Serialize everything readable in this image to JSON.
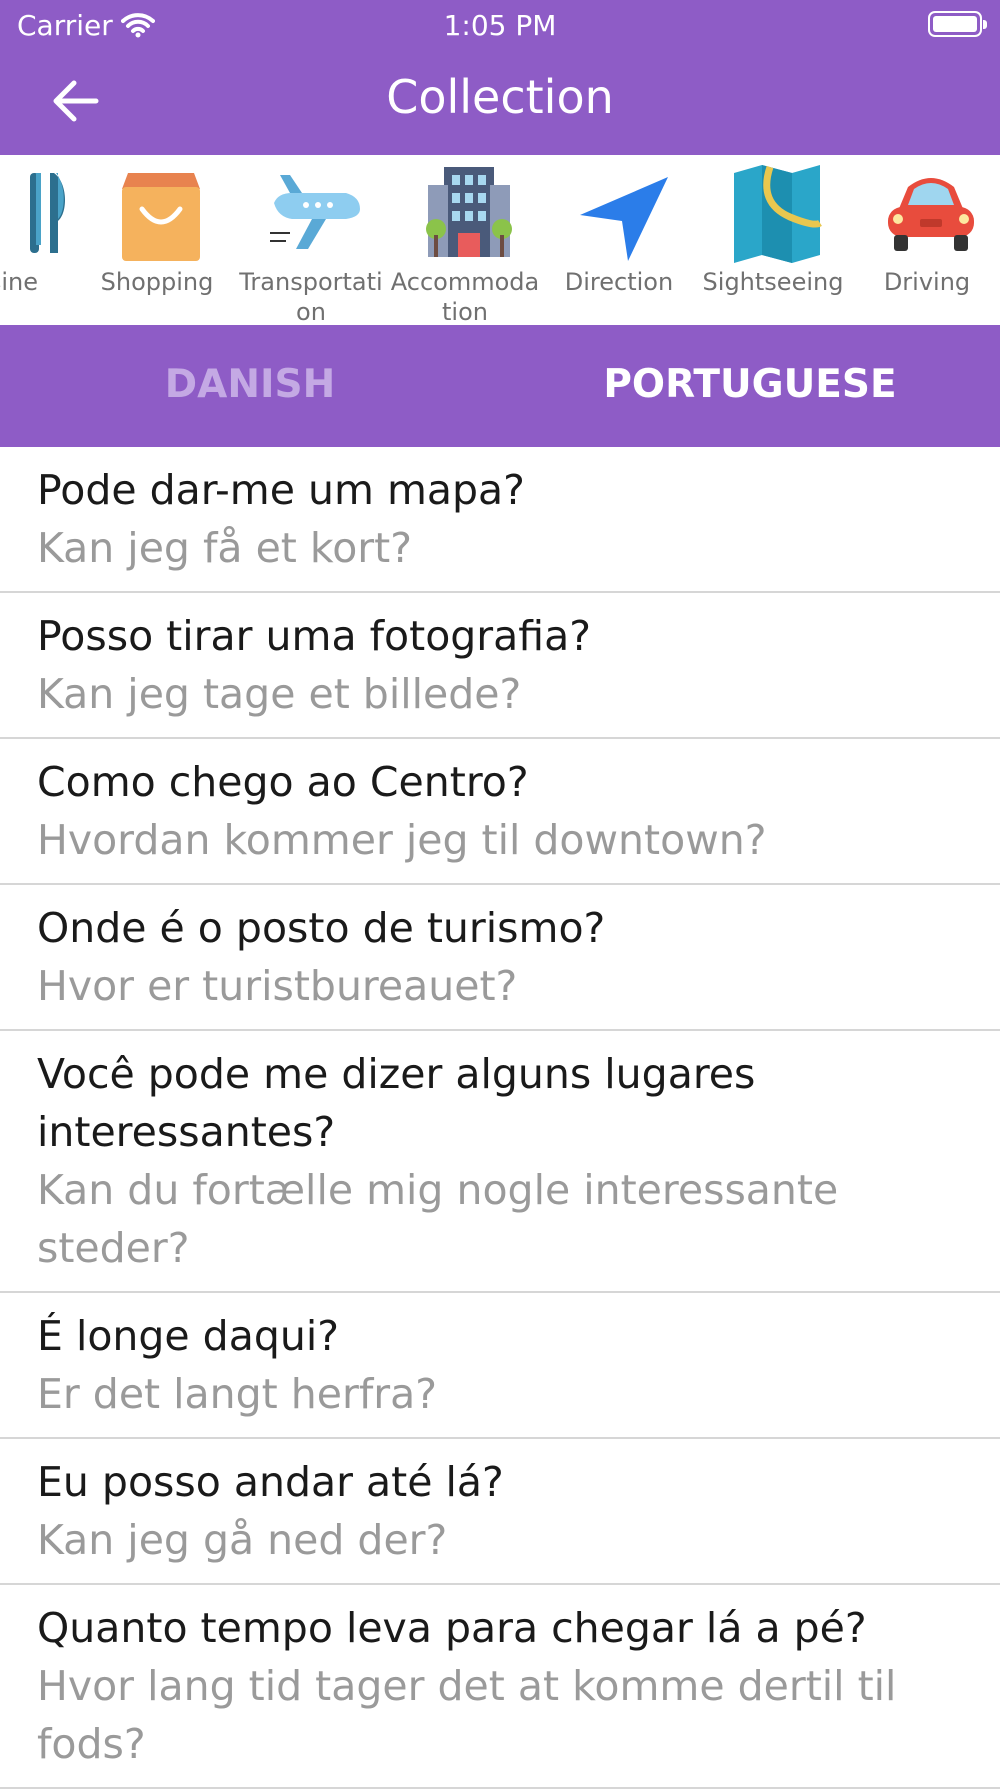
{
  "status_bar": {
    "carrier": "Carrier",
    "time": "1:05 PM"
  },
  "nav": {
    "title": "Collection",
    "back_icon": "arrow-left-icon"
  },
  "categories": [
    {
      "label": "sine",
      "icon": "cutlery-icon"
    },
    {
      "label": "Shopping",
      "icon": "shopping-bag-icon"
    },
    {
      "label": "Transportation",
      "icon": "airplane-icon"
    },
    {
      "label": "Accommodation",
      "icon": "hotel-icon"
    },
    {
      "label": "Direction",
      "icon": "navigation-arrow-icon"
    },
    {
      "label": "Sightseeing",
      "icon": "map-icon"
    },
    {
      "label": "Driving",
      "icon": "car-icon"
    }
  ],
  "languages": {
    "source": "DANISH",
    "target": "PORTUGUESE"
  },
  "phrases": [
    {
      "pt": "Pode dar-me um mapa?",
      "da": "Kan jeg få et kort?"
    },
    {
      "pt": "Posso tirar uma fotografia?",
      "da": "Kan jeg tage et billede?"
    },
    {
      "pt": "Como chego ao Centro?",
      "da": "Hvordan kommer jeg til downtown?"
    },
    {
      "pt": "Onde é o posto de turismo?",
      "da": "Hvor er turistbureauet?"
    },
    {
      "pt": "Você pode me dizer alguns lugares interessantes?",
      "da": "Kan du fortælle mig nogle interessante steder?"
    },
    {
      "pt": "É longe daqui?",
      "da": "Er det langt herfra?"
    },
    {
      "pt": "Eu posso andar até lá?",
      "da": "Kan jeg gå ned der?"
    },
    {
      "pt": "Quanto tempo leva para chegar lá a pé?",
      "da": "Hvor lang tid tager det at komme dertil til fods?"
    }
  ],
  "colors": {
    "primary": "#8e5cc6",
    "inactive_tab": "#c4a9e4",
    "secondary_text": "#9a9a9a"
  }
}
